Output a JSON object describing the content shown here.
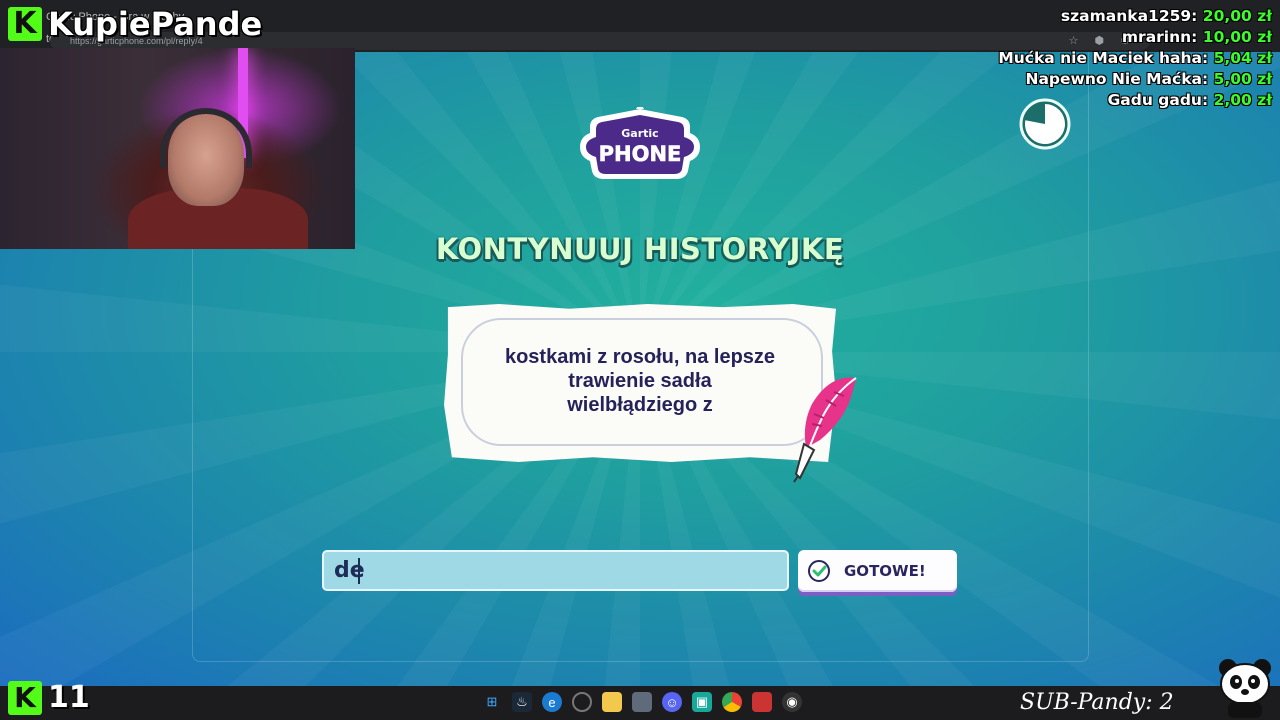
{
  "browser": {
    "tab_title": "Gartic Phone - Gra w głuchy telefon",
    "url": "https://garticphone.com/pl/reply/4"
  },
  "brand": {
    "name": "KupiePande",
    "k_letter": "K"
  },
  "donations": [
    {
      "name": "szamanka1259:",
      "amount": "20,00 zł"
    },
    {
      "name": "mrarinn:",
      "amount": "10,00 zł"
    },
    {
      "name": "Mućka nie Maciek haha:",
      "amount": "5,04 zł"
    },
    {
      "name": "Napewno Nie Maćka:",
      "amount": "5,00 zł"
    },
    {
      "name": "Gadu gadu:",
      "amount": "2,00 zł"
    }
  ],
  "game": {
    "logo_top": "Gartic",
    "logo_bottom": "PHONE",
    "heading": "KONTYNUUJ HISTORYJKĘ",
    "prompt_lines": [
      "kostkami z rosołu, na lepsze",
      "trawienie sadła",
      "wielbłądziego z"
    ],
    "answer_value": "de",
    "done_label": "GOTOWE!",
    "timer_remaining_fraction": 0.78
  },
  "bottom": {
    "kick_letter": "K",
    "viewer_count": "11",
    "sub_label": "SUB-Pandy: 2"
  },
  "colors": {
    "kick_green": "#53fc18",
    "donation_green": "#3cfc2c",
    "heading_mint": "#d7ffd0",
    "quill_pink": "#e8338a"
  }
}
